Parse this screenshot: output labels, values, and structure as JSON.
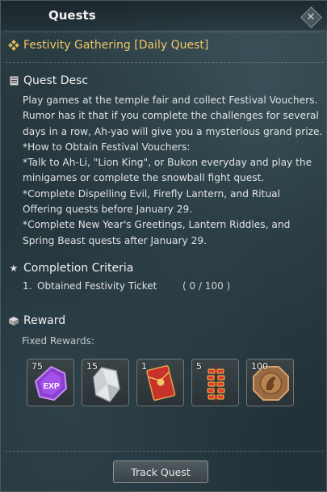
{
  "window": {
    "title": "Quests"
  },
  "quest": {
    "title": "Festivity Gathering [Daily Quest]"
  },
  "sections": {
    "desc": "Quest Desc",
    "criteria": "Completion Criteria",
    "reward": "Reward"
  },
  "description_lines": [
    "Play games at the temple fair and collect Festival Vouchers.",
    "Rumor has it that if you complete the challenges for several",
    "days in a row, Ah-yao will give you a mysterious grand prize.",
    "*How to Obtain Festival Vouchers:",
    "*Talk to Ah-Li, \"Lion King\", or Bukon everyday and play the",
    "minigames or complete the snowball fight quest.",
    "*Complete Dispelling Evil, Firefly Lantern, and Ritual",
    "Offering quests before January 29.",
    "*Complete New Year's Greetings, Lantern Riddles, and",
    "Spring Beast quests after January 29."
  ],
  "criteria": [
    {
      "number": "1.",
      "text": "Obtained Festivity Ticket",
      "count": "( 0 / 100 )"
    }
  ],
  "rewards": {
    "label": "Fixed Rewards:",
    "items": [
      {
        "qty": "75",
        "icon": "exp-crystal-icon"
      },
      {
        "qty": "15",
        "icon": "crystal-shard-icon"
      },
      {
        "qty": "1",
        "icon": "red-envelope-icon"
      },
      {
        "qty": "5",
        "icon": "firecracker-icon"
      },
      {
        "qty": "100",
        "icon": "bronze-horse-medal-icon"
      }
    ]
  },
  "buttons": {
    "track": "Track Quest"
  },
  "colors": {
    "accent": "#f0c667",
    "text": "#e2e2e2",
    "panel": "#2a3a40"
  }
}
